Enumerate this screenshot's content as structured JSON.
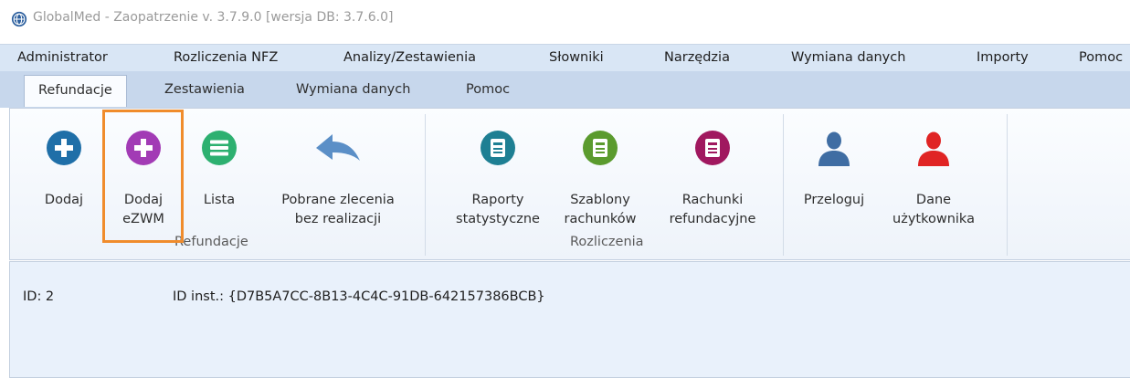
{
  "window": {
    "title": "GlobalMed - Zaopatrzenie v. 3.7.9.0 [wersja DB: 3.7.6.0]"
  },
  "menu": [
    "Administrator",
    "Rozliczenia NFZ",
    "Analizy/Zestawienia",
    "Słowniki",
    "Narzędzia",
    "Wymiana danych",
    "Importy",
    "Pomoc"
  ],
  "tabs": [
    "Refundacje",
    "Zestawienia",
    "Wymiana danych",
    "Pomoc"
  ],
  "active_tab": "Refundacje",
  "ribbon": {
    "groups": [
      "Refundacje",
      "Rozliczenia"
    ],
    "buttons": [
      {
        "line1": "Dodaj",
        "line2": "",
        "icon": "plus-circle-icon",
        "color": "#1f6fa8"
      },
      {
        "line1": "Dodaj",
        "line2": "eZWM",
        "icon": "plus-circle-icon",
        "color": "#a23bb5"
      },
      {
        "line1": "Lista",
        "line2": "",
        "icon": "list-icon",
        "color": "#2db070"
      },
      {
        "line1": "Pobrane zlecenia",
        "line2": "bez realizacji",
        "icon": "back-arrow-icon",
        "color": "#5b8fc7"
      },
      {
        "line1": "Raporty",
        "line2": "statystyczne",
        "icon": "report-icon",
        "color": "#1e7f93"
      },
      {
        "line1": "Szablony",
        "line2": "rachunków",
        "icon": "template-icon",
        "color": "#5b9b2e"
      },
      {
        "line1": "Rachunki",
        "line2": "refundacyjne",
        "icon": "invoice-icon",
        "color": "#a0185f"
      },
      {
        "line1": "Przeloguj",
        "line2": "",
        "icon": "user-icon",
        "color": "#3f6da3"
      },
      {
        "line1": "Dane",
        "line2": "użytkownika",
        "icon": "user-icon",
        "color": "#e02424"
      }
    ]
  },
  "content": {
    "id": "ID: 2",
    "id_inst": "ID inst.: {D7B5A7CC-8B13-4C4C-91DB-642157386BCB}"
  },
  "colors": {
    "highlight": "#f08c2c",
    "menubar": "#d9e6f5",
    "tabbar": "#c7d7ec"
  }
}
